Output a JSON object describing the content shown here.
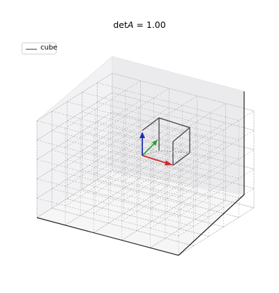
{
  "title": {
    "det_label": "det",
    "matrix_label": "A",
    "equals": " = ",
    "value": "1.00"
  },
  "legend": {
    "entries": [
      {
        "label": "cube",
        "color": "#444444"
      }
    ]
  },
  "scene": {
    "grid_divisions": 5,
    "cube_color": "#444444",
    "axes": [
      {
        "name": "x-axis",
        "color": "#d62728"
      },
      {
        "name": "y-axis",
        "color": "#2ca02c"
      },
      {
        "name": "z-axis",
        "color": "#1f2db4"
      }
    ]
  }
}
